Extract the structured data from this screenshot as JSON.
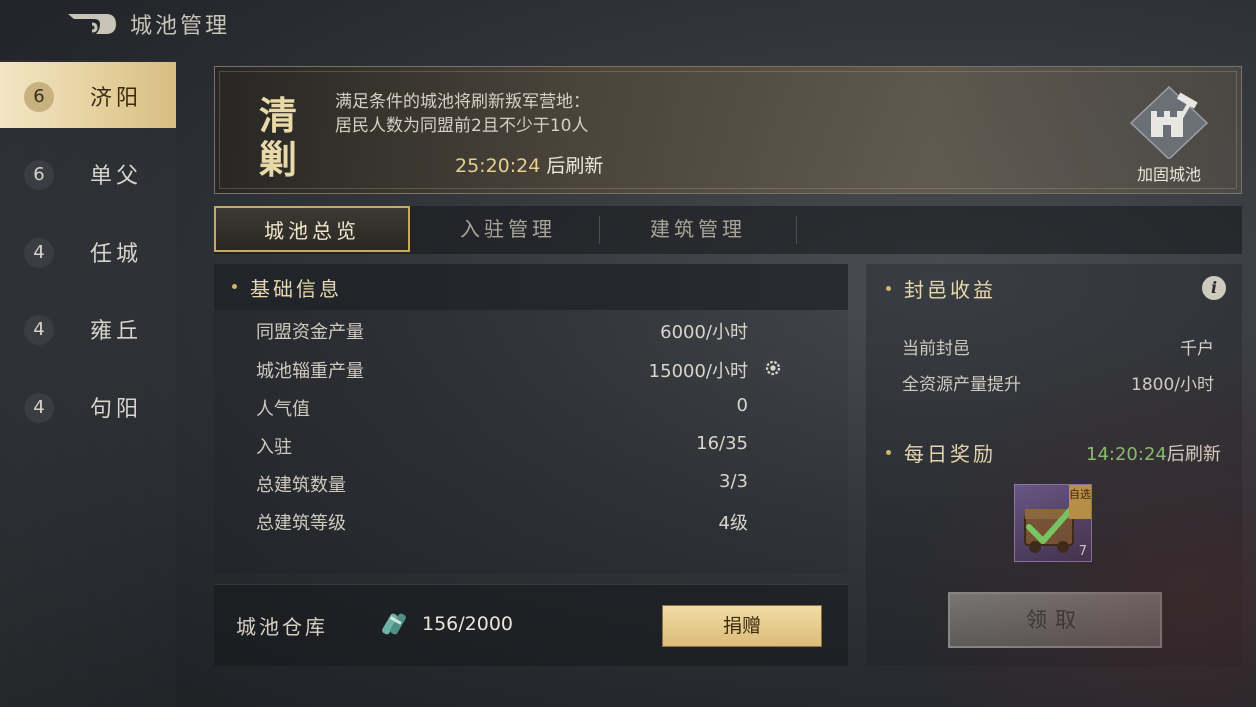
{
  "header": {
    "title": "城池管理"
  },
  "sidebar": {
    "items": [
      {
        "level": "6",
        "name": "济阳"
      },
      {
        "level": "6",
        "name": "单父"
      },
      {
        "level": "4",
        "name": "任城"
      },
      {
        "level": "4",
        "name": "雍丘"
      },
      {
        "level": "4",
        "name": "句阳"
      }
    ]
  },
  "banner": {
    "char1": "清",
    "char2": "剿",
    "line1": "满足条件的城池将刷新叛军营地：",
    "line2": "居民人数为同盟前2且不少于10人",
    "timer": "25:20:24",
    "timer_suffix": "后刷新",
    "fortify_label": "加固城池"
  },
  "tabs": [
    "城池总览",
    "入驻管理",
    "建筑管理"
  ],
  "info": {
    "title": "基础信息",
    "rows": [
      {
        "label": "同盟资金产量",
        "value": "6000/小时"
      },
      {
        "label": "城池辎重产量",
        "value": "15000/小时"
      },
      {
        "label": "人气值",
        "value": "0"
      },
      {
        "label": "入驻",
        "value": "16/35"
      },
      {
        "label": "总建筑数量",
        "value": "3/3"
      },
      {
        "label": "总建筑等级",
        "value": "4级"
      }
    ]
  },
  "storage": {
    "title": "城池仓库",
    "value": "156/2000",
    "donate_label": "捐赠"
  },
  "fief": {
    "title": "封邑收益",
    "info_glyph": "i",
    "rows": [
      {
        "label": "当前封邑",
        "value": "千户"
      },
      {
        "label": "全资源产量提升",
        "value": "1800/小时"
      }
    ],
    "daily_title": "每日奖励",
    "daily_timer": "14:20:24",
    "daily_suffix": "后刷新",
    "reward": {
      "tag": "自选",
      "count": "7"
    },
    "claim_label": "领取"
  },
  "colors": {
    "accent_gold": "#d2b46a",
    "timer_green": "#8fd07a",
    "active_tab_border": "#c9ab5e"
  },
  "icons": [
    "back-arrow-icon",
    "fortress-hammer-icon",
    "gear-icon",
    "info-icon",
    "supply-icon",
    "checkmark-icon"
  ]
}
